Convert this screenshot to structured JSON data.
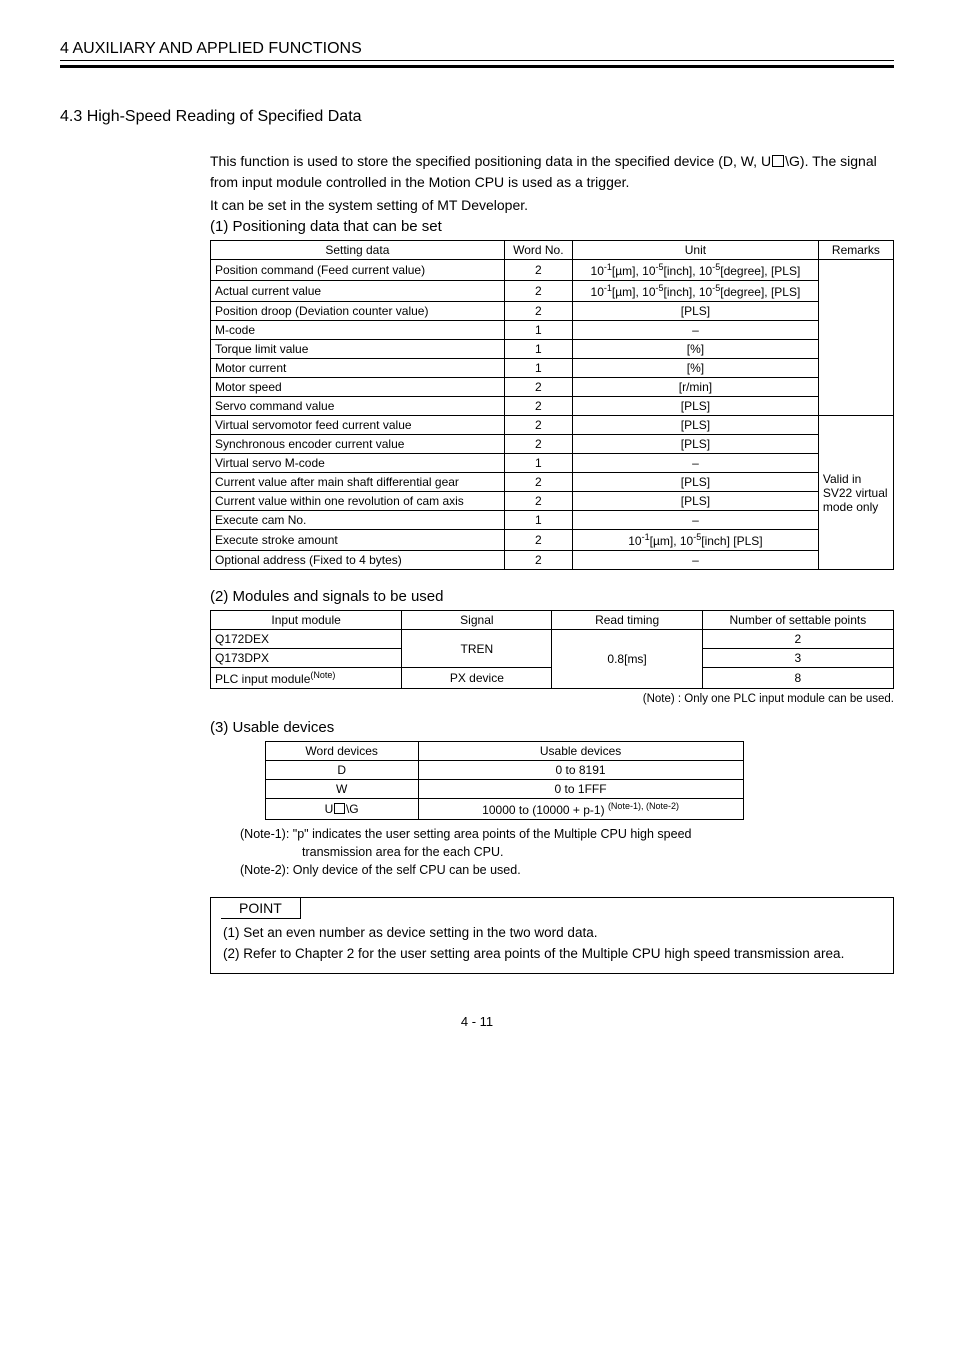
{
  "chapter": "4  AUXILIARY AND APPLIED FUNCTIONS",
  "section": "4.3 High-Speed Reading of Specified Data",
  "intro1a": "This function is used to store the specified positioning data in the specified device (D, W, U",
  "intro1b": "\\G). The signal from input module controlled in the Motion CPU is used as a trigger.",
  "intro2": "It can be set in the system setting of MT Developer.",
  "h1": "(1)  Positioning data that can be set",
  "t1": {
    "head": [
      "Setting data",
      "Word No.",
      "Unit",
      "Remarks"
    ],
    "rows": [
      {
        "a": "Position command (Feed current value)",
        "b": "2",
        "u_html": "10<sup>-1</sup>[µm], 10<sup>-5</sup>[inch], 10<sup>-5</sup>[degree], [PLS]"
      },
      {
        "a": "Actual current value",
        "b": "2",
        "u_html": "10<sup>-1</sup>[µm], 10<sup>-5</sup>[inch], 10<sup>-5</sup>[degree], [PLS]"
      },
      {
        "a": "Position droop (Deviation counter value)",
        "b": "2",
        "u": "[PLS]"
      },
      {
        "a": "M-code",
        "b": "1",
        "u": "–"
      },
      {
        "a": "Torque limit value",
        "b": "1",
        "u": "[%]"
      },
      {
        "a": "Motor current",
        "b": "1",
        "u": "[%]"
      },
      {
        "a": "Motor speed",
        "b": "2",
        "u": "[r/min]"
      },
      {
        "a": "Servo command value",
        "b": "2",
        "u": "[PLS]"
      }
    ],
    "rows2": [
      {
        "a": "Virtual servomotor feed current value",
        "b": "2",
        "u": "[PLS]"
      },
      {
        "a": "Synchronous encoder current value",
        "b": "2",
        "u": "[PLS]"
      },
      {
        "a": "Virtual servo M-code",
        "b": "1",
        "u": "–"
      },
      {
        "a": "Current value after main shaft differential gear",
        "b": "2",
        "u": "[PLS]"
      },
      {
        "a": "Current value within one revolution of cam axis",
        "b": "2",
        "u": "[PLS]"
      },
      {
        "a": "Execute cam No.",
        "b": "1",
        "u": "–"
      },
      {
        "a": "Execute stroke amount",
        "b": "2",
        "u_html": "10<sup>-1</sup>[µm], 10<sup>-5</sup>[inch] [PLS]"
      },
      {
        "a": "Optional address (Fixed to 4 bytes)",
        "b": "2",
        "u": "–"
      }
    ],
    "remarks2": "Valid in SV22 virtual mode only"
  },
  "h2": "(2)  Modules and signals to be used",
  "t2": {
    "head": [
      "Input module",
      "Signal",
      "Read timing",
      "Number of settable points"
    ],
    "r1": {
      "a": "Q172DEX",
      "d": "2"
    },
    "r2": {
      "a": "Q173DPX",
      "d": "3"
    },
    "r3": {
      "a_html": "PLC input module<sup>(Note)</sup>",
      "b": "PX device",
      "d": "8"
    },
    "sig": "TREN",
    "timing": "0.8[ms]"
  },
  "t2note": "(Note) : Only one PLC input module can be used.",
  "h3": "(3)  Usable devices",
  "t3": {
    "head": [
      "Word devices",
      "Usable devices"
    ],
    "rows": [
      {
        "a": "D",
        "b": "0 to 8191"
      },
      {
        "a": "W",
        "b": "0 to 1FFF"
      }
    ],
    "lastB_html": "10000 to (10000 + p-1) <sup>(Note-1), (Note-2)</sup>"
  },
  "notes": {
    "n1a": "(Note-1):  \"p\" indicates the user setting area points of the Multiple CPU high speed",
    "n1b": "transmission area for the each CPU.",
    "n2": "(Note-2):  Only device of the self CPU can be used."
  },
  "point": {
    "label": "POINT",
    "p1": "(1)  Set an even number as device setting in the two word data.",
    "p2": "(2)  Refer to Chapter 2 for the user setting area points of the Multiple CPU high speed transmission area."
  },
  "page": "4 - 11"
}
